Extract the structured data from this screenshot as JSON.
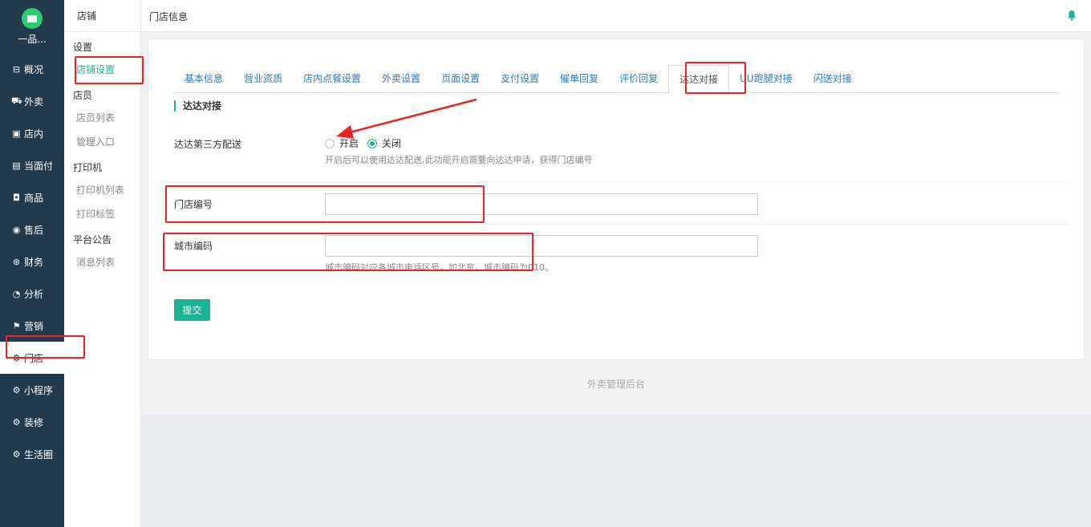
{
  "brand": {
    "name": "一品..."
  },
  "nav": {
    "items": [
      {
        "label": "概况",
        "icon": "dashboard-icon"
      },
      {
        "label": "外卖",
        "icon": "delivery-icon"
      },
      {
        "label": "店内",
        "icon": "store-icon"
      },
      {
        "label": "当面付",
        "icon": "payment-icon"
      },
      {
        "label": "商品",
        "icon": "goods-icon"
      },
      {
        "label": "售后",
        "icon": "aftersale-icon"
      },
      {
        "label": "财务",
        "icon": "finance-icon"
      },
      {
        "label": "分析",
        "icon": "analysis-icon"
      },
      {
        "label": "营销",
        "icon": "marketing-icon"
      },
      {
        "label": "门店",
        "icon": "gear-icon"
      },
      {
        "label": "小程序",
        "icon": "gear-icon"
      },
      {
        "label": "装修",
        "icon": "gear-icon"
      },
      {
        "label": "生活圈",
        "icon": "gear-icon"
      }
    ],
    "active": "门店"
  },
  "submenu": {
    "title": "店铺",
    "group_settings": "设置",
    "item_store_settings": "店铺设置",
    "group_staff": "店员",
    "item_staff_list": "店员列表",
    "item_manage_entry": "管理入口",
    "group_printer": "打印机",
    "item_printer_list": "打印机列表",
    "item_print_label": "打印标签",
    "group_notice": "平台公告",
    "item_message_list": "消息列表"
  },
  "topbar": {
    "title": "门店信息"
  },
  "tabs": [
    "基本信息",
    "营业资质",
    "店内点餐设置",
    "外卖设置",
    "页面设置",
    "支付设置",
    "催单回复",
    "评价回复",
    "达达对接",
    "UU跑腿对接",
    "闪送对接"
  ],
  "active_tab": "达达对接",
  "form": {
    "section_title": "达达对接",
    "delivery_label": "达达第三方配送",
    "radio_on": "开启",
    "radio_off": "关闭",
    "selected": "关闭",
    "delivery_help": "开启后可以使用达达配送,此功能开启需要向达达申请，获得门店编号",
    "store_no_label": "门店编号",
    "store_no_value": "",
    "city_code_label": "城市编码",
    "city_code_value": "",
    "city_code_help": "城市编码对应各城市电话区号，如北京，城市编码为010。",
    "submit": "提交"
  },
  "footer": "外卖管理后台",
  "colors": {
    "accent": "#1ab394",
    "nav_bg": "#223a4c",
    "annotation": "#ee2222",
    "link": "#337ab7"
  }
}
